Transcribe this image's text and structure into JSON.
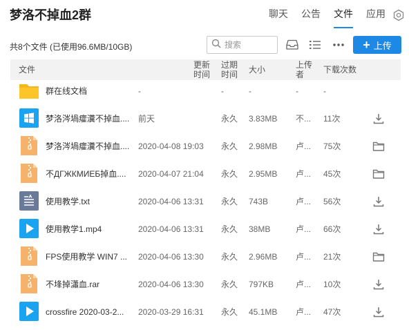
{
  "header": {
    "title": "梦洛不掉血2群",
    "tabs": [
      {
        "label": "聊天",
        "active": false
      },
      {
        "label": "公告",
        "active": false
      },
      {
        "label": "文件",
        "active": true
      },
      {
        "label": "应用",
        "active": false
      }
    ]
  },
  "toolbar": {
    "summary": "共8个文件 (已使用96.6MB/10GB)",
    "search_placeholder": "搜索",
    "upload_label": "上传"
  },
  "table": {
    "headers": {
      "file": "文件",
      "updated_line1": "更新",
      "updated_line2": "时间",
      "expire_line1": "过期",
      "expire_line2": "时间",
      "size": "大小",
      "uploader_line1": "上传",
      "uploader_line2": "者",
      "downloads": "下载次数"
    },
    "rows": [
      {
        "icon": "folder-icon",
        "name": "群在线文档",
        "time": "-",
        "expire": "-",
        "size": "-",
        "uploader": "-",
        "count": "-",
        "action": ""
      },
      {
        "icon": "windows-file-icon",
        "name": "梦洛涔堝癨瀵不掉血....",
        "time": "前天",
        "expire": "永久",
        "size": "3.83MB",
        "uploader": "不...",
        "count": "11次",
        "action": "download-icon"
      },
      {
        "icon": "zip-file-icon",
        "name": "梦洛涔堝癨瀵不掉血....",
        "time": "2020-04-08 19:03",
        "expire": "永久",
        "size": "2.98MB",
        "uploader": "卢...",
        "count": "75次",
        "action": "open-folder-icon"
      },
      {
        "icon": "zip-file-icon",
        "name": "不ДГЖКМИЕБ掉血....",
        "time": "2020-04-07 21:04",
        "expire": "永久",
        "size": "2.95MB",
        "uploader": "卢...",
        "count": "45次",
        "action": "open-folder-icon"
      },
      {
        "icon": "text-file-icon",
        "name": "使用教学.txt",
        "time": "2020-04-06 13:31",
        "expire": "永久",
        "size": "743B",
        "uploader": "卢...",
        "count": "56次",
        "action": "download-icon"
      },
      {
        "icon": "video-file-icon",
        "name": "使用教学1.mp4",
        "time": "2020-04-06 13:31",
        "expire": "永久",
        "size": "38MB",
        "uploader": "卢...",
        "count": "66次",
        "action": "download-icon"
      },
      {
        "icon": "zip-file-icon",
        "name": "FPS使用教学 WIN7 ...",
        "time": "2020-04-06 13:30",
        "expire": "永久",
        "size": "2.96MB",
        "uploader": "卢...",
        "count": "21次",
        "action": "open-folder-icon"
      },
      {
        "icon": "zip-file-icon",
        "name": "不埄掉瀟血.rar",
        "time": "2020-04-06 13:30",
        "expire": "永久",
        "size": "797KB",
        "uploader": "卢...",
        "count": "10次",
        "action": "download-icon"
      },
      {
        "icon": "video-file-icon",
        "name": "crossfire 2020-03-2...",
        "time": "2020-03-29 16:31",
        "expire": "永久",
        "size": "45.1MB",
        "uploader": "卢...",
        "count": "47次",
        "action": "download-icon"
      }
    ]
  },
  "colors": {
    "accent": "#1e88e5",
    "folder": "#fcc62b",
    "zip": "#f6b26b",
    "windows": "#1aa3f0",
    "video": "#1aa3f0",
    "text_file": "#6b7a99"
  }
}
